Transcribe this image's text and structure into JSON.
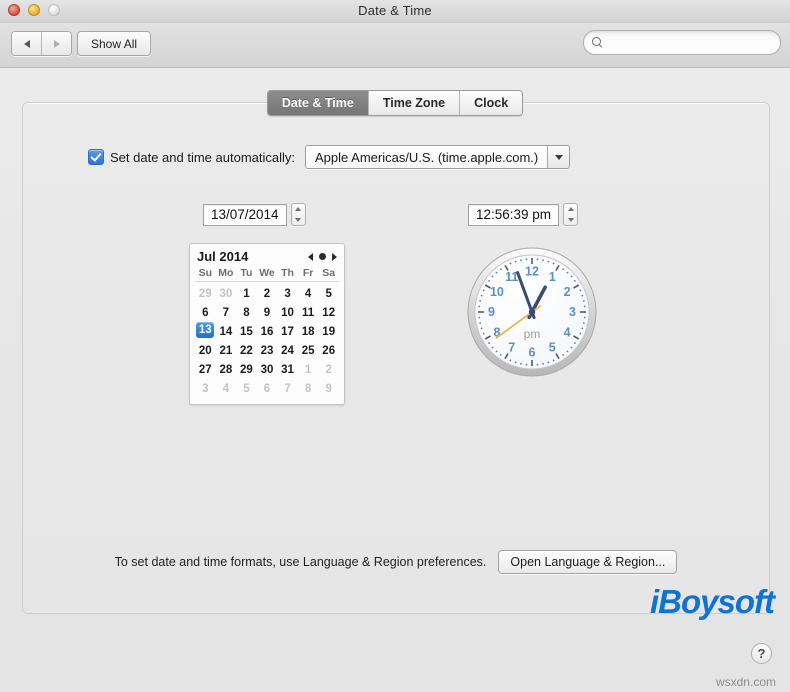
{
  "window": {
    "title": "Date & Time",
    "traffic_lights": [
      "close-button",
      "minimize-button",
      "zoom-button"
    ]
  },
  "toolbar": {
    "back_icon": "triangle-left-icon",
    "forward_icon": "triangle-right-icon",
    "show_all_label": "Show All",
    "search": {
      "icon": "search-icon",
      "value": "",
      "placeholder": ""
    }
  },
  "tabs": [
    {
      "label": "Date & Time",
      "active": true
    },
    {
      "label": "Time Zone",
      "active": false
    },
    {
      "label": "Clock",
      "active": false
    }
  ],
  "auto_row": {
    "checked": true,
    "label": "Set date and time automatically:",
    "server_value": "Apple Americas/U.S. (time.apple.com.)",
    "dropdown_icon": "chevron-down-icon"
  },
  "date_field": {
    "value": "13/07/2014",
    "stepper_up_icon": "stepper-up-icon",
    "stepper_down_icon": "stepper-down-icon"
  },
  "time_field": {
    "value": "12:56:39 pm",
    "stepper_up_icon": "stepper-up-icon",
    "stepper_down_icon": "stepper-down-icon"
  },
  "calendar": {
    "month_label": "Jul 2014",
    "nav": {
      "prev_icon": "triangle-left-icon",
      "today_icon": "dot-icon",
      "next_icon": "triangle-right-icon"
    },
    "day_headers": [
      "Su",
      "Mo",
      "Tu",
      "We",
      "Th",
      "Fr",
      "Sa"
    ],
    "weeks": [
      [
        {
          "d": "29",
          "muted": true
        },
        {
          "d": "30",
          "muted": true
        },
        {
          "d": "1"
        },
        {
          "d": "2"
        },
        {
          "d": "3"
        },
        {
          "d": "4"
        },
        {
          "d": "5"
        }
      ],
      [
        {
          "d": "6"
        },
        {
          "d": "7"
        },
        {
          "d": "8"
        },
        {
          "d": "9"
        },
        {
          "d": "10"
        },
        {
          "d": "11"
        },
        {
          "d": "12"
        }
      ],
      [
        {
          "d": "13",
          "selected": true
        },
        {
          "d": "14"
        },
        {
          "d": "15"
        },
        {
          "d": "16"
        },
        {
          "d": "17"
        },
        {
          "d": "18"
        },
        {
          "d": "19"
        }
      ],
      [
        {
          "d": "20"
        },
        {
          "d": "21"
        },
        {
          "d": "22"
        },
        {
          "d": "23"
        },
        {
          "d": "24"
        },
        {
          "d": "25"
        },
        {
          "d": "26"
        }
      ],
      [
        {
          "d": "27"
        },
        {
          "d": "28"
        },
        {
          "d": "29"
        },
        {
          "d": "30"
        },
        {
          "d": "31"
        },
        {
          "d": "1",
          "muted": true
        },
        {
          "d": "2",
          "muted": true
        }
      ],
      [
        {
          "d": "3",
          "muted": true
        },
        {
          "d": "4",
          "muted": true
        },
        {
          "d": "5",
          "muted": true
        },
        {
          "d": "6",
          "muted": true
        },
        {
          "d": "7",
          "muted": true
        },
        {
          "d": "8",
          "muted": true
        },
        {
          "d": "9",
          "muted": true
        }
      ]
    ]
  },
  "clock": {
    "meridiem_label": "pm",
    "hour": 12,
    "minute": 56,
    "second": 39,
    "numerals": [
      "12",
      "1",
      "2",
      "3",
      "4",
      "5",
      "6",
      "7",
      "8",
      "9",
      "10",
      "11"
    ],
    "numeral_color": "#5a8fc7",
    "hand_color": "#3a4a74",
    "second_hand_color": "#e8b84b"
  },
  "footer": {
    "note": "To set date and time formats, use Language & Region preferences.",
    "button_label": "Open Language & Region..."
  },
  "watermarks": {
    "brand": "iBoysoft",
    "brand_color": "#0e72d6",
    "site": "wsxdn.com"
  },
  "help": {
    "label": "?"
  }
}
